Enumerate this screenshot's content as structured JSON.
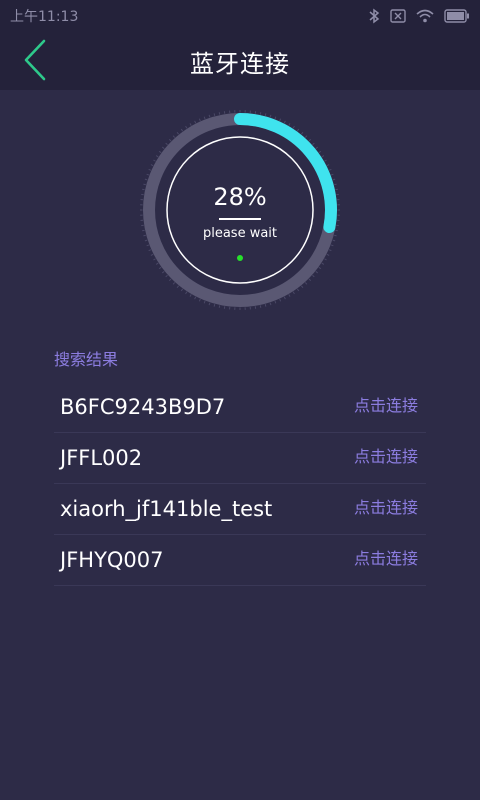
{
  "status_bar": {
    "time": "上午11:13",
    "icons": [
      "bluetooth-icon",
      "no-sim-icon",
      "wifi-icon",
      "battery-icon"
    ]
  },
  "header": {
    "title": "蓝牙连接",
    "back_icon": "chevron-left-icon"
  },
  "progress": {
    "percent_text": "28%",
    "fraction": 0.28,
    "message": "please wait"
  },
  "results": {
    "title": "搜索结果",
    "connect_label": "点击连接",
    "devices": [
      {
        "name": "B6FC9243B9D7",
        "action": "点击连接"
      },
      {
        "name": "JFFL002",
        "action": "点击连接"
      },
      {
        "name": "xiaorh_jf141ble_test",
        "action": "点击连接"
      },
      {
        "name": "JFHYQ007",
        "action": "点击连接"
      }
    ]
  },
  "colors": {
    "background": "#2d2b47",
    "header": "#24223a",
    "accent": "#3fe3ee",
    "back_arrow": "#2ec98b",
    "link": "#8c7de0",
    "indicator": "#27e02b"
  }
}
